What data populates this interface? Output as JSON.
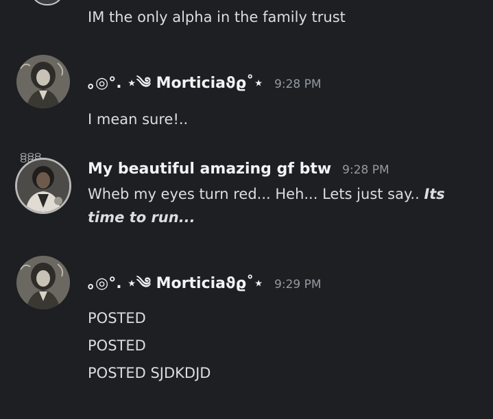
{
  "messages": [
    {
      "text": "IM the only alpha in the family trust"
    },
    {
      "username": "｡◎°. ⋆༄ Morticiaϑϱ˚⋆",
      "timestamp": "9:28 PM",
      "text": "I mean sure!.."
    },
    {
      "username": "My beautiful amazing gf btw",
      "timestamp": "9:28 PM",
      "text_plain": "Wheb my eyes turn red... Heh... Lets just say.. ",
      "text_emphasis": "Its time to run..."
    },
    {
      "username": "｡◎°. ⋆༄ Morticiaϑϱ˚⋆",
      "timestamp": "9:29 PM",
      "lines": [
        "POSTED",
        "POSTED",
        "POSTED SJDKDJD"
      ]
    }
  ],
  "colors": {
    "background": "#1e1f22",
    "username": "#f2f3f5",
    "timestamp": "#949ba4",
    "text": "#dbdee1"
  },
  "icons": [
    "avatar-morticia",
    "avatar-gf"
  ]
}
